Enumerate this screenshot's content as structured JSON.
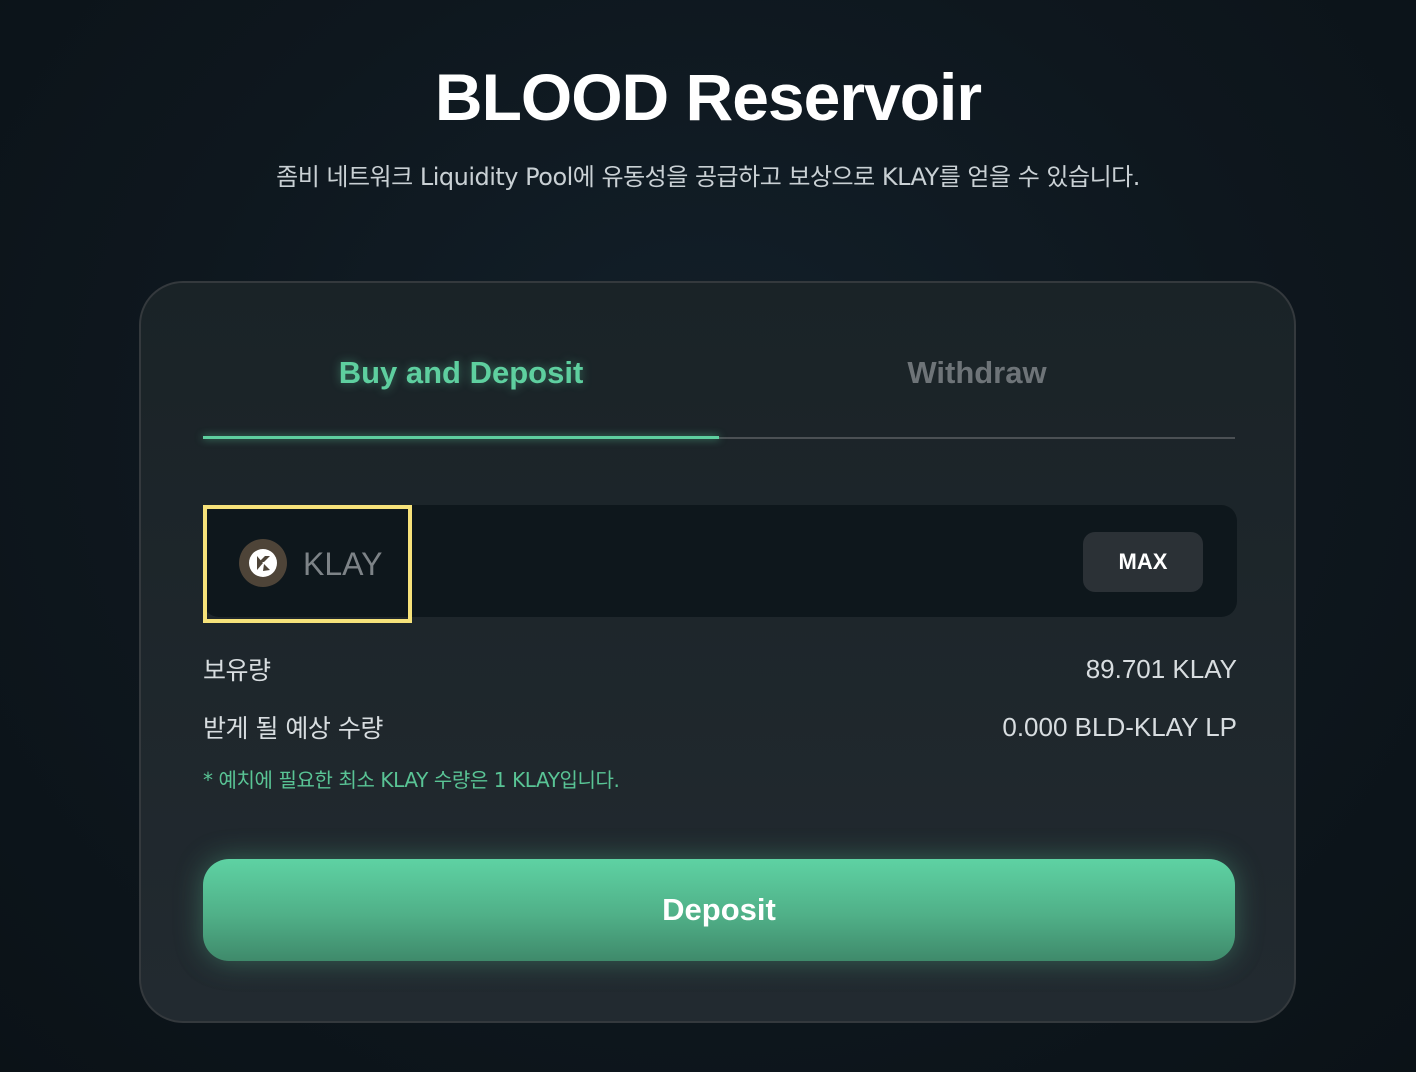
{
  "header": {
    "title": "BLOOD Reservoir",
    "subtitle": "좀비 네트워크 Liquidity Pool에 유동성을 공급하고 보상으로 KLAY를 얻을 수 있습니다."
  },
  "tabs": [
    {
      "label": "Buy and Deposit",
      "active": true
    },
    {
      "label": "Withdraw",
      "active": false
    }
  ],
  "input": {
    "token_symbol": "KLAY",
    "token_icon": "klaytn-logo-icon",
    "amount": "",
    "max_label": "MAX"
  },
  "info": {
    "balance_label": "보유량",
    "balance_value": "89.701 KLAY",
    "expected_label": "받게 될 예상 수량",
    "expected_value": "0.000 BLD-KLAY LP",
    "note": "* 예치에 필요한 최소 KLAY 수량은 1 KLAY입니다."
  },
  "actions": {
    "deposit_label": "Deposit"
  },
  "colors": {
    "accent": "#5ecf9f",
    "highlight": "#f6e27a",
    "background": "#0e171e",
    "card": "#1e272c"
  }
}
